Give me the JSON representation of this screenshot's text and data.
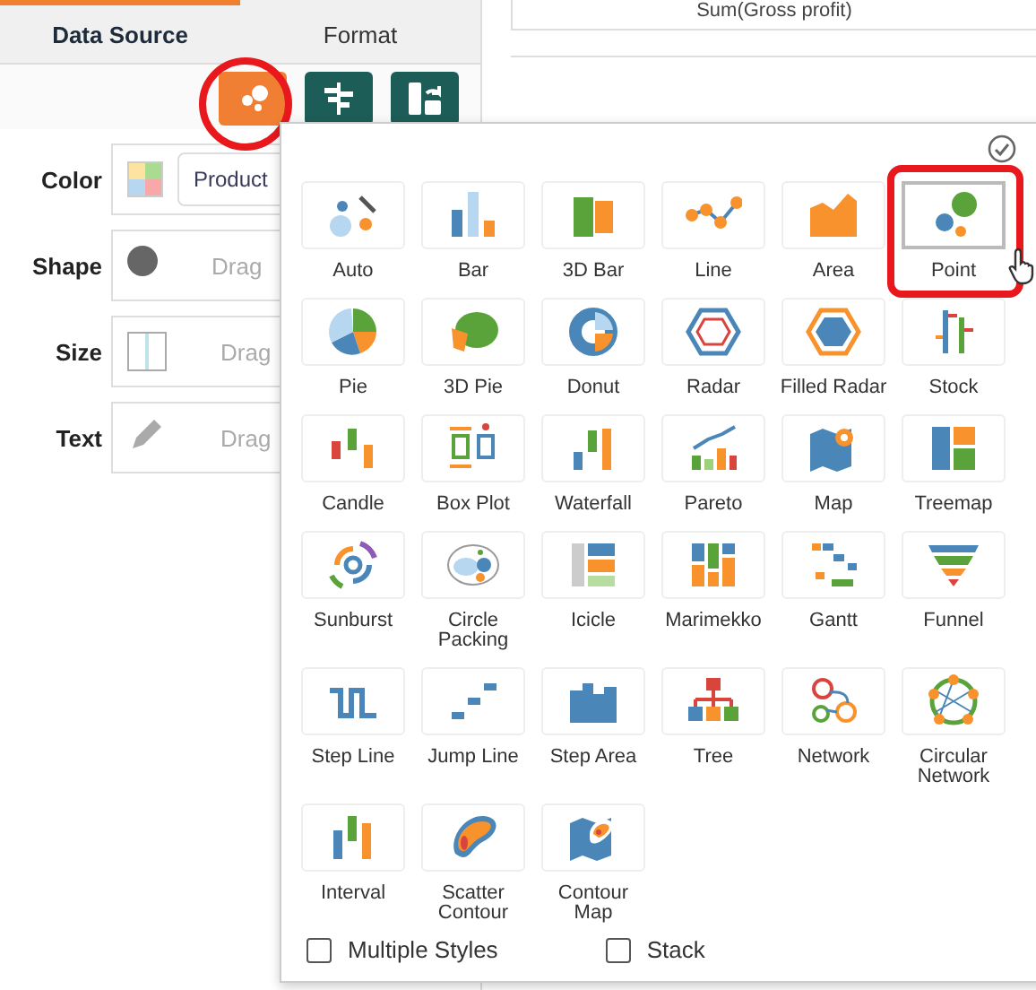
{
  "tabs": [
    {
      "label": "Data Source",
      "selected": true
    },
    {
      "label": "Format",
      "selected": false
    }
  ],
  "toolbar": [
    {
      "kind": "chart-type",
      "selected": true
    },
    {
      "kind": "align",
      "selected": false
    },
    {
      "kind": "swap",
      "selected": false
    }
  ],
  "bindings": [
    {
      "label": "Color",
      "kind": "color",
      "value": "Product"
    },
    {
      "label": "Shape",
      "kind": "shape",
      "placeholder": "Drag"
    },
    {
      "label": "Size",
      "kind": "size",
      "placeholder": "Drag"
    },
    {
      "label": "Text",
      "kind": "text",
      "placeholder": "Drag"
    }
  ],
  "measure_box": {
    "label": "Sum(Gross profit)"
  },
  "chart_types": [
    {
      "kind": "auto",
      "label": "Auto",
      "selected": false
    },
    {
      "kind": "bar",
      "label": "Bar",
      "selected": false
    },
    {
      "kind": "bar3d",
      "label": "3D Bar",
      "selected": false
    },
    {
      "kind": "line",
      "label": "Line",
      "selected": false
    },
    {
      "kind": "area",
      "label": "Area",
      "selected": false
    },
    {
      "kind": "point",
      "label": "Point",
      "selected": true
    },
    {
      "kind": "pie",
      "label": "Pie",
      "selected": false
    },
    {
      "kind": "pie3d",
      "label": "3D Pie",
      "selected": false
    },
    {
      "kind": "donut",
      "label": "Donut",
      "selected": false
    },
    {
      "kind": "radar",
      "label": "Radar",
      "selected": false
    },
    {
      "kind": "filledradar",
      "label": "Filled Radar",
      "selected": false
    },
    {
      "kind": "stock",
      "label": "Stock",
      "selected": false
    },
    {
      "kind": "candle",
      "label": "Candle",
      "selected": false
    },
    {
      "kind": "boxplot",
      "label": "Box Plot",
      "selected": false
    },
    {
      "kind": "waterfall",
      "label": "Waterfall",
      "selected": false
    },
    {
      "kind": "pareto",
      "label": "Pareto",
      "selected": false
    },
    {
      "kind": "map",
      "label": "Map",
      "selected": false
    },
    {
      "kind": "treemap",
      "label": "Treemap",
      "selected": false
    },
    {
      "kind": "sunburst",
      "label": "Sunburst",
      "selected": false
    },
    {
      "kind": "circlepacking",
      "label": "Circle Packing",
      "selected": false
    },
    {
      "kind": "icicle",
      "label": "Icicle",
      "selected": false
    },
    {
      "kind": "marimekko",
      "label": "Marimekko",
      "selected": false
    },
    {
      "kind": "gantt",
      "label": "Gantt",
      "selected": false
    },
    {
      "kind": "funnel",
      "label": "Funnel",
      "selected": false
    },
    {
      "kind": "stepline",
      "label": "Step Line",
      "selected": false
    },
    {
      "kind": "jumpline",
      "label": "Jump Line",
      "selected": false
    },
    {
      "kind": "steparea",
      "label": "Step Area",
      "selected": false
    },
    {
      "kind": "tree",
      "label": "Tree",
      "selected": false
    },
    {
      "kind": "network",
      "label": "Network",
      "selected": false
    },
    {
      "kind": "circularnetwork",
      "label": "Circular Network",
      "selected": false
    },
    {
      "kind": "interval",
      "label": "Interval",
      "selected": false
    },
    {
      "kind": "scattercontour",
      "label": "Scatter Contour",
      "selected": false
    },
    {
      "kind": "contourmap",
      "label": "Contour Map",
      "selected": false
    }
  ],
  "options": [
    {
      "label": "Multiple Styles",
      "checked": false
    },
    {
      "label": "Stack",
      "checked": false
    }
  ]
}
